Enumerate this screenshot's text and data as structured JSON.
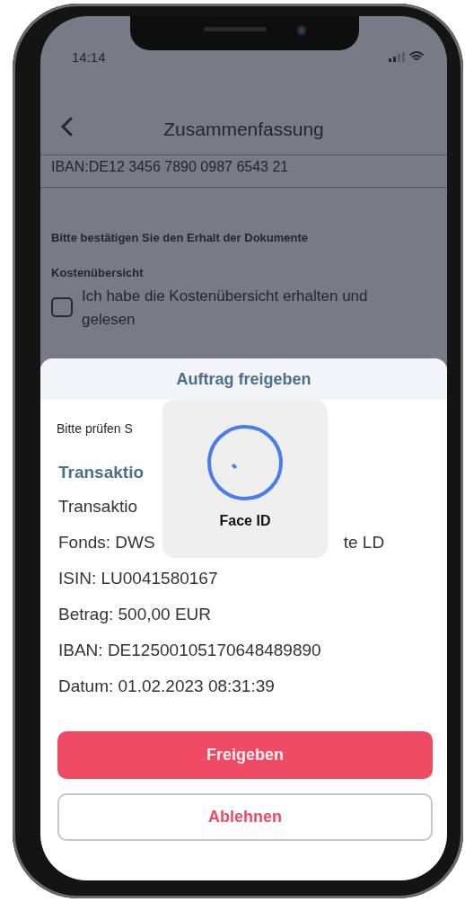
{
  "status_bar": {
    "time": "14:14"
  },
  "header": {
    "title": "Zusammenfassung"
  },
  "account": {
    "iban": "IBAN:DE12 3456 7890 0987 6543 21"
  },
  "documents": {
    "heading": "Bitte bestätigen Sie den Erhalt der Dokumente",
    "section_title": "Kostenübersicht",
    "checkbox": {
      "label": "Ich habe die Kostenübersicht erhalten und gelesen",
      "checked": false
    }
  },
  "sheet": {
    "title": "Auftrag freigeben",
    "intro": "Bitte prüfen S",
    "section_title": "Transaktio",
    "details": [
      {
        "text": "Transaktio"
      },
      {
        "text": "Fonds: DWS",
        "text_after": "te LD"
      },
      {
        "text": "ISIN: LU0041580167"
      },
      {
        "text": "Betrag: 500,00 EUR"
      },
      {
        "text": "IBAN: DE12500105170648489890"
      },
      {
        "text": "Datum: 01.02.2023  08:31:39"
      }
    ],
    "buttons": [
      {
        "label": "Freigeben",
        "kind": "primary"
      },
      {
        "label": "Ablehnen",
        "kind": "secondary"
      }
    ]
  },
  "face_id": {
    "label": "Face ID"
  }
}
